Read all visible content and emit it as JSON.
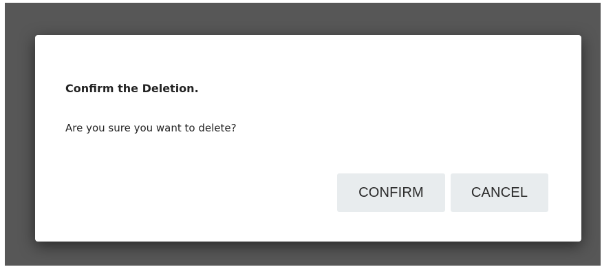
{
  "dialog": {
    "title": "Confirm the Deletion.",
    "message": "Are you sure you want to delete?",
    "confirm_label": "CONFIRM",
    "cancel_label": "CANCEL"
  },
  "colors": {
    "backdrop": "#575757",
    "dialog_background": "#ffffff",
    "button_background": "#e8ecee",
    "text": "#222222"
  }
}
